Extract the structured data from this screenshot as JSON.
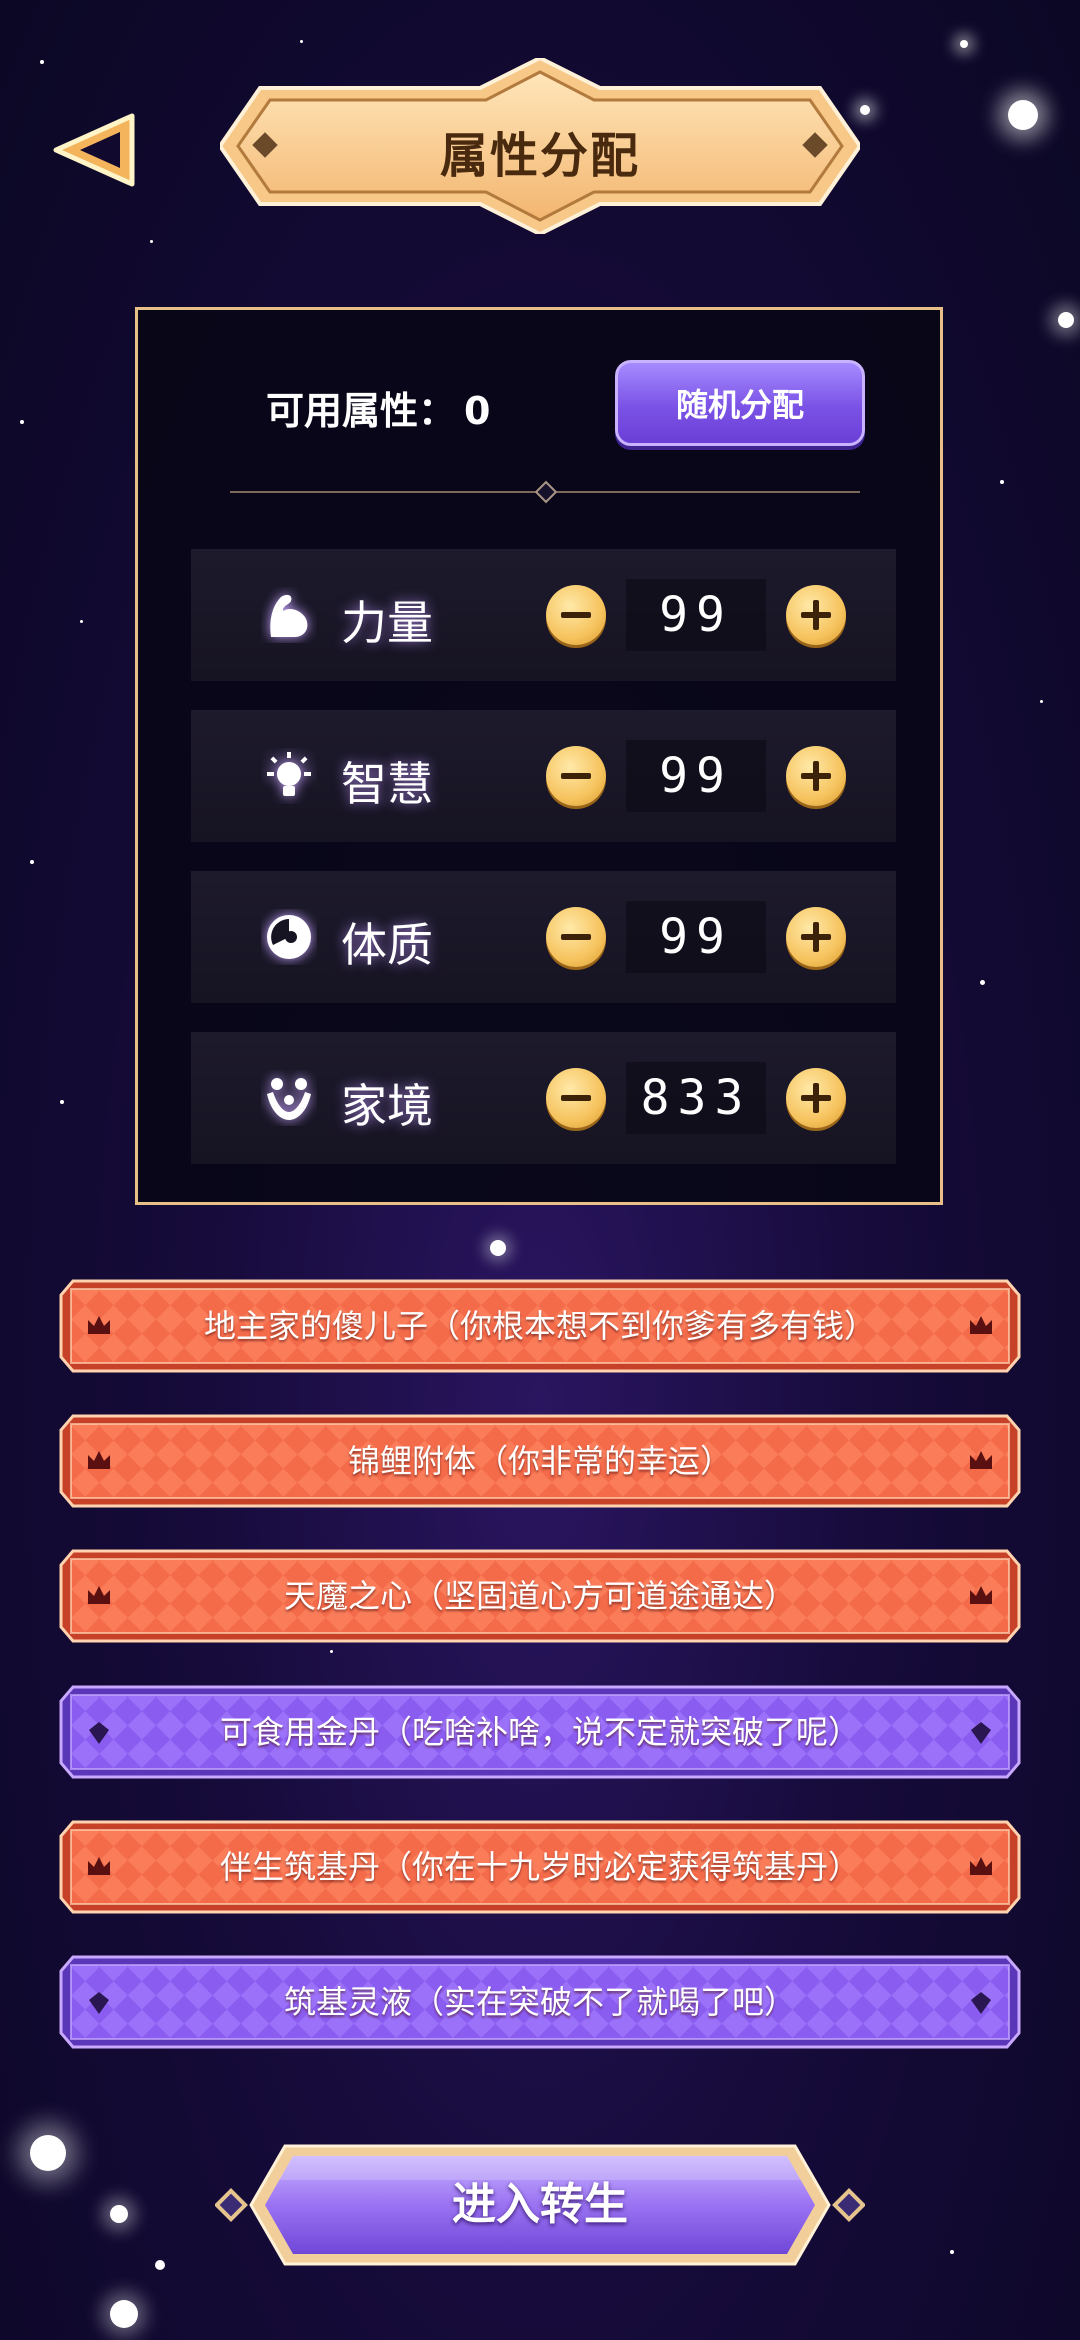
{
  "header": {
    "title": "属性分配",
    "back_icon": "back-arrow-icon"
  },
  "panel": {
    "available_label": "可用属性：",
    "available_value": "0",
    "random_button": "随机分配",
    "stats": [
      {
        "label": "力量",
        "value": "99",
        "icon": "arm-muscle-icon"
      },
      {
        "label": "智慧",
        "value": "99",
        "icon": "lightbulb-icon"
      },
      {
        "label": "体质",
        "value": "99",
        "icon": "body-constitution-icon"
      },
      {
        "label": "家境",
        "value": "833",
        "icon": "family-icon"
      }
    ]
  },
  "traits": [
    {
      "text": "地主家的傻儿子（你根本想不到你爹有多有钱）",
      "color": "orange",
      "icon": "crown-icon"
    },
    {
      "text": "锦鲤附体（你非常的幸运）",
      "color": "orange",
      "icon": "crown-icon"
    },
    {
      "text": "天魔之心（坚固道心方可道途通达）",
      "color": "orange",
      "icon": "crown-icon"
    },
    {
      "text": "可食用金丹（吃啥补啥，说不定就突破了呢）",
      "color": "purple",
      "icon": "diamond-icon"
    },
    {
      "text": "伴生筑基丹（你在十九岁时必定获得筑基丹）",
      "color": "orange",
      "icon": "crown-icon"
    },
    {
      "text": "筑基灵液（实在突破不了就喝了吧）",
      "color": "purple",
      "icon": "diamond-icon"
    }
  ],
  "enter_button": "进入转生",
  "colors": {
    "orange_banner": "#f46b4a",
    "purple_banner": "#8a5cf0",
    "gold_frame": "#e8bf87"
  }
}
